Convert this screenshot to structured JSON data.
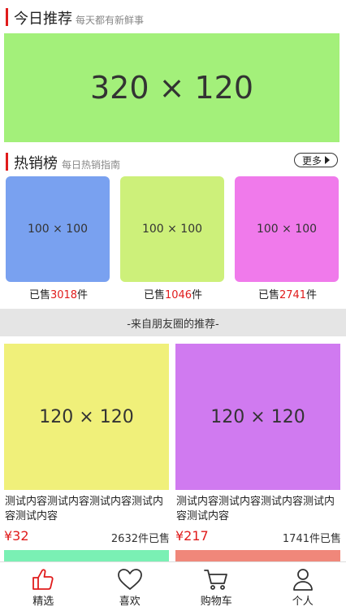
{
  "today": {
    "title": "今日推荐",
    "subtitle": "每天都有新鲜事",
    "banner_text": "320 × 120",
    "banner_color": "#a3f07a"
  },
  "hot": {
    "title": "热销榜",
    "subtitle": "每日热销指南",
    "more_label": "更多",
    "sold_prefix": "已售",
    "sold_suffix": "件",
    "items": [
      {
        "image_text": "100 × 100",
        "color": "#79a1f0",
        "sold": "3018"
      },
      {
        "image_text": "100 × 100",
        "color": "#cdf07a",
        "sold": "1046"
      },
      {
        "image_text": "100 × 100",
        "color": "#f07aeb",
        "sold": "2741"
      }
    ]
  },
  "friends_label": "-来自朋友圈的推荐-",
  "products": [
    {
      "image_text": "120 × 120",
      "color": "#f0f07a",
      "desc": "测试内容测试内容测试内容测试内容测试内容",
      "price": "¥32",
      "sold": "2632件已售"
    },
    {
      "image_text": "120 × 120",
      "color": "#d07af0",
      "desc": "测试内容测试内容测试内容测试内容测试内容",
      "price": "¥217",
      "sold": "1741件已售"
    }
  ],
  "peek_colors": [
    "#7af0b4",
    "#f0877a"
  ],
  "tabs": [
    {
      "label": "精选",
      "icon": "thumbs-up-icon",
      "active": true
    },
    {
      "label": "喜欢",
      "icon": "heart-icon",
      "active": false
    },
    {
      "label": "购物车",
      "icon": "cart-icon",
      "active": false
    },
    {
      "label": "个人",
      "icon": "person-icon",
      "active": false
    }
  ],
  "colors": {
    "accent": "#e01b1b",
    "band": "#e5e5e5"
  }
}
